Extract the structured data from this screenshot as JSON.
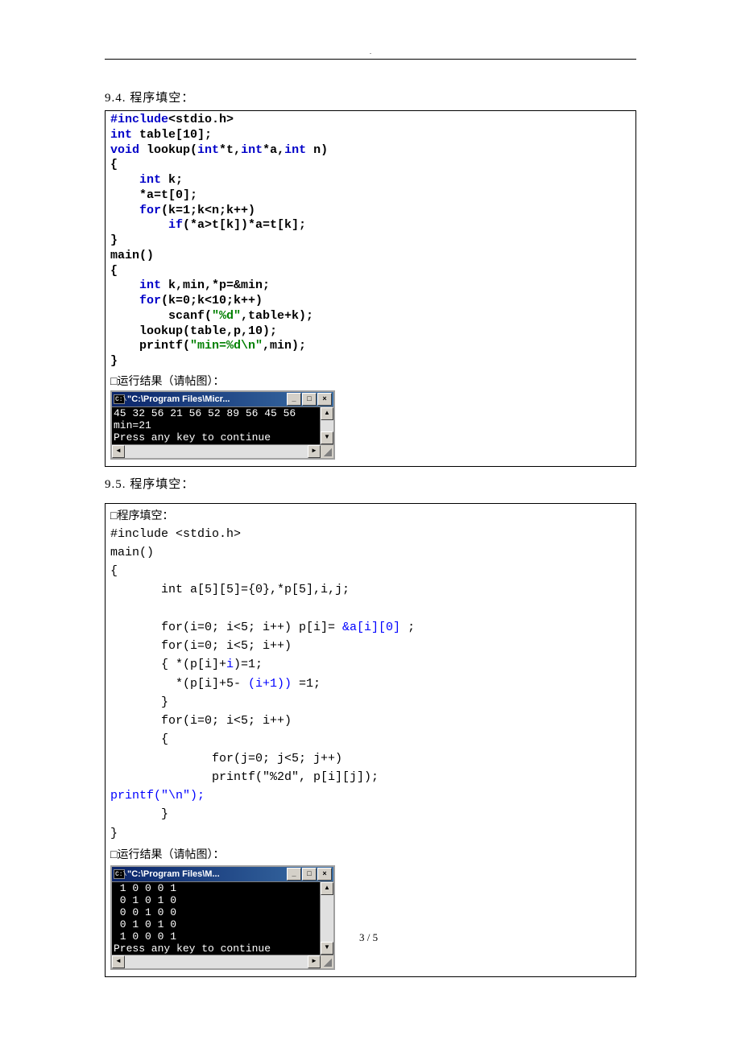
{
  "heading_94": "9.4. 程序填空：",
  "code94": {
    "l1a": "#include",
    "l1b": "<stdio.h>",
    "l2a": "int",
    "l2b": " table[10];",
    "l3a": "void",
    "l3b": " lookup(",
    "l3c": "int",
    "l3d": "*t,",
    "l3e": "int",
    "l3f": "*a,",
    "l3g": "int",
    "l3h": " n)",
    "l4": "{",
    "l5a": "    ",
    "l5b": "int",
    "l5c": " k;",
    "l6": "    *a=t[0];",
    "l7a": "    ",
    "l7b": "for",
    "l7c": "(k=1;k<n;k++)",
    "l8a": "        ",
    "l8b": "if",
    "l8c": "(*a>t[k])*a=t[k];",
    "l9": "}",
    "l10": "main()",
    "l11": "{",
    "l12a": "    ",
    "l12b": "int",
    "l12c": " k,min,*p=&min;",
    "l13a": "    ",
    "l13b": "for",
    "l13c": "(k=0;k<10;k++)",
    "l14a": "        scanf(",
    "l14b": "\"%d\"",
    "l14c": ",table+k);",
    "l15": "    lookup(table,p,10);",
    "l16a": "    printf(",
    "l16b": "\"min=%d\\n\"",
    "l16c": ",min);",
    "l17": "}"
  },
  "caption_run": "□运行结果（请帖图）：",
  "console94": {
    "title": "\"C:\\Program Files\\Micr...",
    "lines": "45 32 56 21 56 52 89 56 45 56\nmin=21\nPress any key to continue"
  },
  "heading_95": "9.5. 程序填空：",
  "box95_caption": "□程序填空：",
  "code95": {
    "l1": "#include <stdio.h>",
    "l2": "main()",
    "l3": "{",
    "l4": "       int a[5][5]={0},*p[5],i,j;",
    "blank1": "",
    "l5a": "       for(i=0; i<5; i++) p[i]= ",
    "l5b": "&a[i][0]",
    "l5c": " ;",
    "l6": "       for(i=0; i<5; i++)",
    "l7a": "       { *(p[i]+",
    "l7b": "i",
    "l7c": ")=1;",
    "l8a": "         *(p[i]+5- ",
    "l8b": "(i+1))",
    "l8c": " =1;",
    "l9": "       }",
    "l10": "       for(i=0; i<5; i++)",
    "l11": "       {",
    "l12": "              for(j=0; j<5; j++)",
    "l13": "              printf(\"%2d\", p[i][j]);",
    "l14": "printf(\"\\n\");",
    "l15": "       }",
    "l16": "}"
  },
  "caption_run2": "□运行结果（请帖图）：",
  "console95": {
    "title": "\"C:\\Program Files\\M...",
    "lines": " 1 0 0 0 1\n 0 1 0 1 0\n 0 0 1 0 0\n 0 1 0 1 0\n 1 0 0 0 1\nPress any key to continue"
  },
  "page_number": "3 / 5"
}
